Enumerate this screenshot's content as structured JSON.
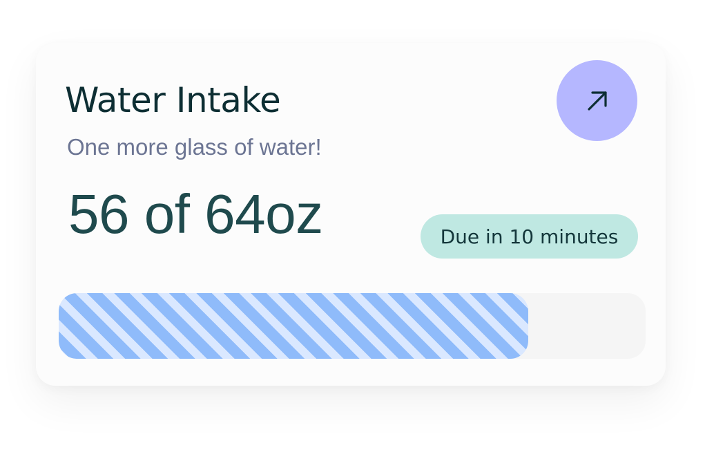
{
  "card": {
    "title": "Water Intake",
    "subtitle": "One more glass of water!",
    "amount_text": "56 of 64oz",
    "due_badge": "Due in 10 minutes",
    "open_icon": "arrow-up-right-icon",
    "progress": {
      "current": 56,
      "goal": 64,
      "unit": "oz"
    }
  },
  "colors": {
    "accent_button": "#b5b7ff",
    "badge_background": "#bfe8e2",
    "progress_stripe_dark": "#8fbbfa",
    "progress_stripe_light": "#dae8ff",
    "title_text": "#0d2e33",
    "subtitle_text": "#6c7593"
  }
}
